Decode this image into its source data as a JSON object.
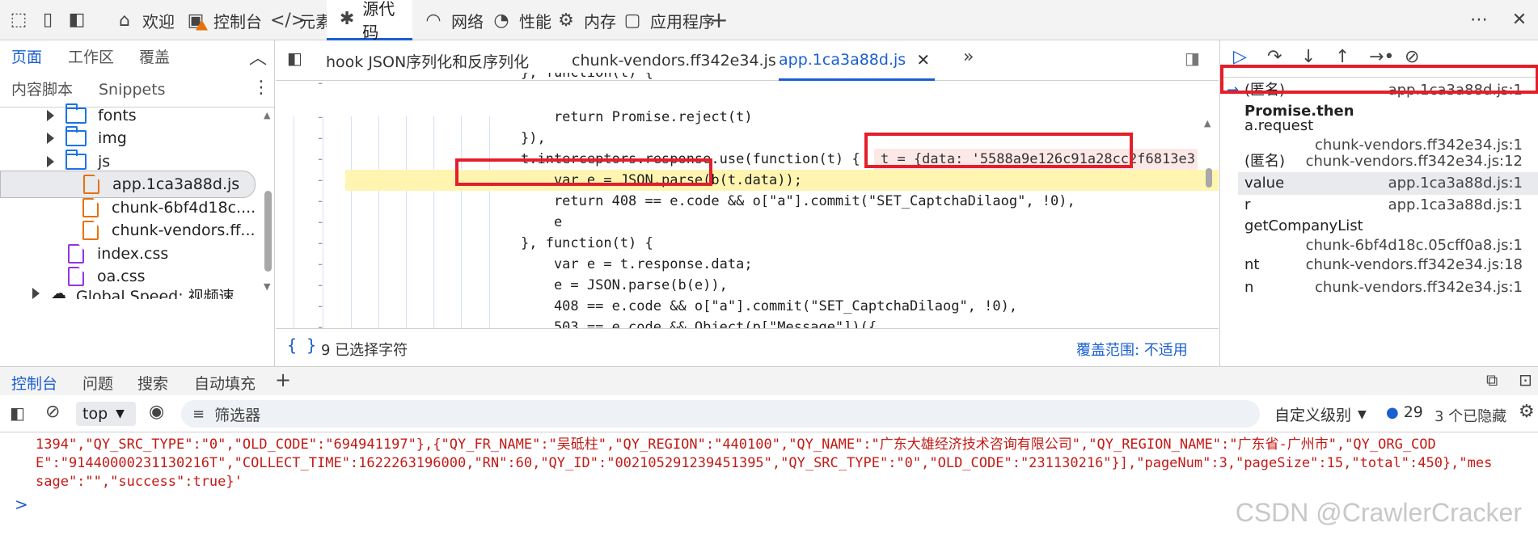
{
  "toolbar": {
    "tabs": [
      {
        "label": "欢迎",
        "icon": "home-icon"
      },
      {
        "label": "控制台",
        "icon": "console-icon"
      },
      {
        "label": "元素",
        "icon": "code-icon"
      },
      {
        "label": "源代码",
        "icon": "bug-icon"
      },
      {
        "label": "网络",
        "icon": "wifi-icon"
      },
      {
        "label": "性能",
        "icon": "performance-icon"
      },
      {
        "label": "内存",
        "icon": "memory-icon"
      },
      {
        "label": "应用程序",
        "icon": "application-icon"
      }
    ],
    "active_tab": "源代码"
  },
  "navigator": {
    "tabs": [
      "页面",
      "工作区",
      "覆盖",
      "内容脚本",
      "Snippets"
    ],
    "tree": [
      {
        "label": "fonts",
        "type": "folder"
      },
      {
        "label": "img",
        "type": "folder"
      },
      {
        "label": "js",
        "type": "folder"
      },
      {
        "label": "app.1ca3a88d.js",
        "type": "js",
        "selected": true
      },
      {
        "label": "chunk-6bf4d18c....",
        "type": "js"
      },
      {
        "label": "chunk-vendors.ff...",
        "type": "js"
      },
      {
        "label": "index.css",
        "type": "css"
      },
      {
        "label": "oa.css",
        "type": "css"
      },
      {
        "label": "Global Speed: 视频速",
        "type": "cloud"
      }
    ]
  },
  "editor": {
    "tabs": [
      "hook JSON序列化和反序列化",
      "chunk-vendors.ff342e34.js",
      "app.1ca3a88d.js"
    ],
    "active_tab": "app.1ca3a88d.js",
    "tooltip": "t = {data: '5588a9e126c91a28cc2f6813e3",
    "status_left": "9 已选择字符",
    "status_right": "覆盖范围: 不适用",
    "lines": [
      "}, function(t) {",
      "    return Promise.reject(t)",
      "}),",
      "t.interceptors.response.use(function(t) {",
      "    var e = JSON.parse(b(t.data));",
      "    return 408 == e.code && o[\"a\"].commit(\"SET_CaptchaDilaog\", !0),",
      "    e",
      "}, function(t) {",
      "    var e = t.response.data;",
      "    e = JSON.parse(b(e)),",
      "    408 == e.code && o[\"a\"].commit(\"SET_CaptchaDilaog\", !0),",
      "    503 == e.code && Object(p[\"Message\"])({"
    ]
  },
  "callstack": [
    {
      "fn": "(匿名)",
      "loc": "app.1ca3a88d.js:1",
      "current": true
    },
    {
      "fn": "Promise.then",
      "loc": "",
      "bold": true
    },
    {
      "fn": "a.request",
      "loc": "chunk-vendors.ff342e34.js:1"
    },
    {
      "fn": "(匿名)",
      "loc": "chunk-vendors.ff342e34.js:12"
    },
    {
      "fn": "value",
      "loc": "app.1ca3a88d.js:1",
      "selected": true
    },
    {
      "fn": "r",
      "loc": "app.1ca3a88d.js:1"
    },
    {
      "fn": "getCompanyList",
      "loc": "chunk-6bf4d18c.05cff0a8.js:1"
    },
    {
      "fn": "nt",
      "loc": "chunk-vendors.ff342e34.js:18"
    },
    {
      "fn": "n",
      "loc": "chunk-vendors.ff342e34.js:1"
    }
  ],
  "console": {
    "tabs": [
      "控制台",
      "问题",
      "搜索",
      "自动填充"
    ],
    "context": "top",
    "filter_placeholder": "筛选器",
    "level": "自定义级别",
    "issues_count": "29",
    "hidden": "3 个已隐藏",
    "output": [
      "1394\",\"QY_SRC_TYPE\":\"0\",\"OLD_CODE\":\"694941197\"},{\"QY_FR_NAME\":\"吴砥柱\",\"QY_REGION\":\"440100\",\"QY_NAME\":\"广东大雄经济技术咨询有限公司\",\"QY_REGION_NAME\":\"广东省-广州市\",\"QY_ORG_COD",
      "E\":\"91440000231130216T\",\"COLLECT_TIME\":1622263196000,\"RN\":60,\"QY_ID\":\"002105291239451395\",\"QY_SRC_TYPE\":\"0\",\"OLD_CODE\":\"231130216\"}],\"pageNum\":3,\"pageSize\":15,\"total\":450},\"mes",
      "sage\":\"\",\"success\":true}'"
    ],
    "prompt": ">"
  },
  "watermark": "CSDN @CrawlerCracker"
}
